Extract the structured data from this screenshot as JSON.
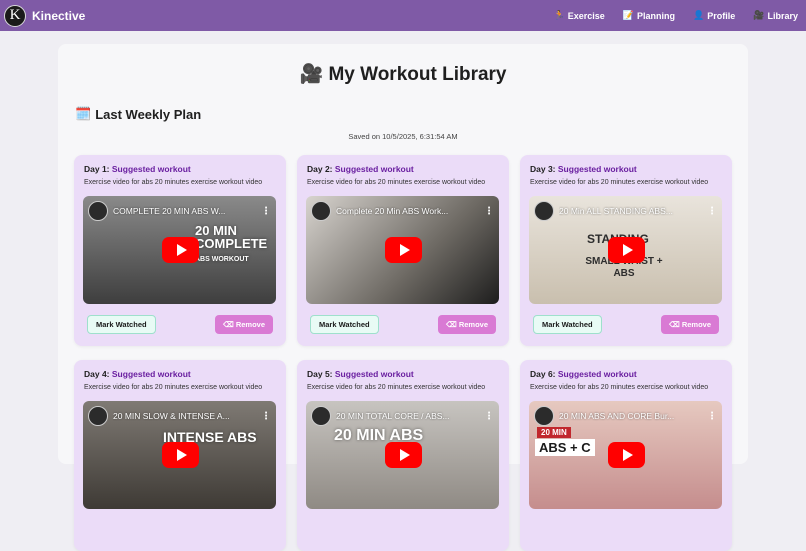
{
  "nav": {
    "brand": "Kinective",
    "logo_letter": "K",
    "items": [
      {
        "label": "Exercise",
        "icon": "person-icon"
      },
      {
        "label": "Planning",
        "icon": "memo-icon"
      },
      {
        "label": "Profile",
        "icon": "person-icon"
      },
      {
        "label": "Library",
        "icon": "video-camera-icon"
      }
    ]
  },
  "page": {
    "title": "My Workout Library",
    "section_title": "Last Weekly Plan",
    "saved_text": "Saved on 10/5/2025, 6:31:54 AM"
  },
  "buttons": {
    "mark_watched": "Mark Watched",
    "remove": "Remove"
  },
  "cards": [
    {
      "day": "Day 1:",
      "link": "Suggested workout",
      "desc": "Exercise video for abs 20 minutes exercise workout video",
      "video_title": "COMPLETE 20 MIN ABS W...",
      "overlay1": "20 MIN COMPLETE",
      "overlay2": "ABS WORKOUT"
    },
    {
      "day": "Day 2:",
      "link": "Suggested workout",
      "desc": "Exercise video for abs 20 minutes exercise workout video",
      "video_title": "Complete 20 Min ABS Work...",
      "overlay1": "",
      "overlay2": ""
    },
    {
      "day": "Day 3:",
      "link": "Suggested workout",
      "desc": "Exercise video for abs 20 minutes exercise workout video",
      "video_title": "20 Min ALL STANDING ABS...",
      "overlay1": "STANDING",
      "overlay2": "SMALL WAIST + ABS"
    },
    {
      "day": "Day 4:",
      "link": "Suggested workout",
      "desc": "Exercise video for abs 20 minutes exercise workout video",
      "video_title": "20 MIN SLOW & INTENSE A...",
      "overlay1": "INTENSE ABS",
      "overlay2": ""
    },
    {
      "day": "Day 5:",
      "link": "Suggested workout",
      "desc": "Exercise video for abs 20 minutes exercise workout video",
      "video_title": "20 MIN TOTAL CORE / ABS...",
      "overlay1": "20 MIN ABS",
      "overlay2": ""
    },
    {
      "day": "Day 6:",
      "link": "Suggested workout",
      "desc": "Exercise video for abs 20 minutes exercise workout video",
      "video_title": "20 MIN ABS AND CORE Bur...",
      "overlay1": "20 MIN",
      "overlay2": "ABS + C"
    }
  ]
}
